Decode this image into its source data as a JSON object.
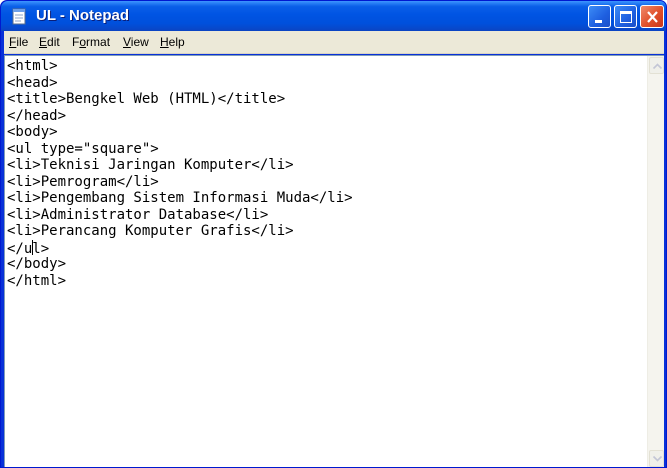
{
  "window": {
    "title": "UL - Notepad",
    "title_icon": "notepad-icon",
    "controls": [
      "minimize-icon",
      "maximize-icon",
      "close-icon"
    ],
    "colors": {
      "titlebar": "#0054e3",
      "close": "#e0502b",
      "menubar": "#ece9d8",
      "editor": "#ffffff"
    }
  },
  "menu": {
    "file": {
      "first": "F",
      "rest": "ile"
    },
    "edit": {
      "first": "E",
      "rest": "dit"
    },
    "format": {
      "pre": "F",
      "u": "o",
      "rest": "rmat"
    },
    "view": {
      "first": "V",
      "rest": "iew"
    },
    "help": {
      "first": "H",
      "rest": "elp"
    }
  },
  "editor": {
    "lines": [
      "<html>",
      "<head>",
      "<title>Bengkel Web (HTML)</title>",
      "</head>",
      "<body>",
      "<ul type=\"square\">",
      "<li>Teknisi Jaringan Komputer</li>",
      "<li>Pemrogram</li>",
      "<li>Pengembang Sistem Informasi Muda</li>",
      "<li>Administrator Database</li>",
      "<li>Perancang Komputer Grafis</li>",
      "</ul>",
      "</body>",
      "</html>"
    ],
    "caret_line": 12,
    "caret_split": {
      "before": "</u",
      "after": "l>"
    }
  }
}
